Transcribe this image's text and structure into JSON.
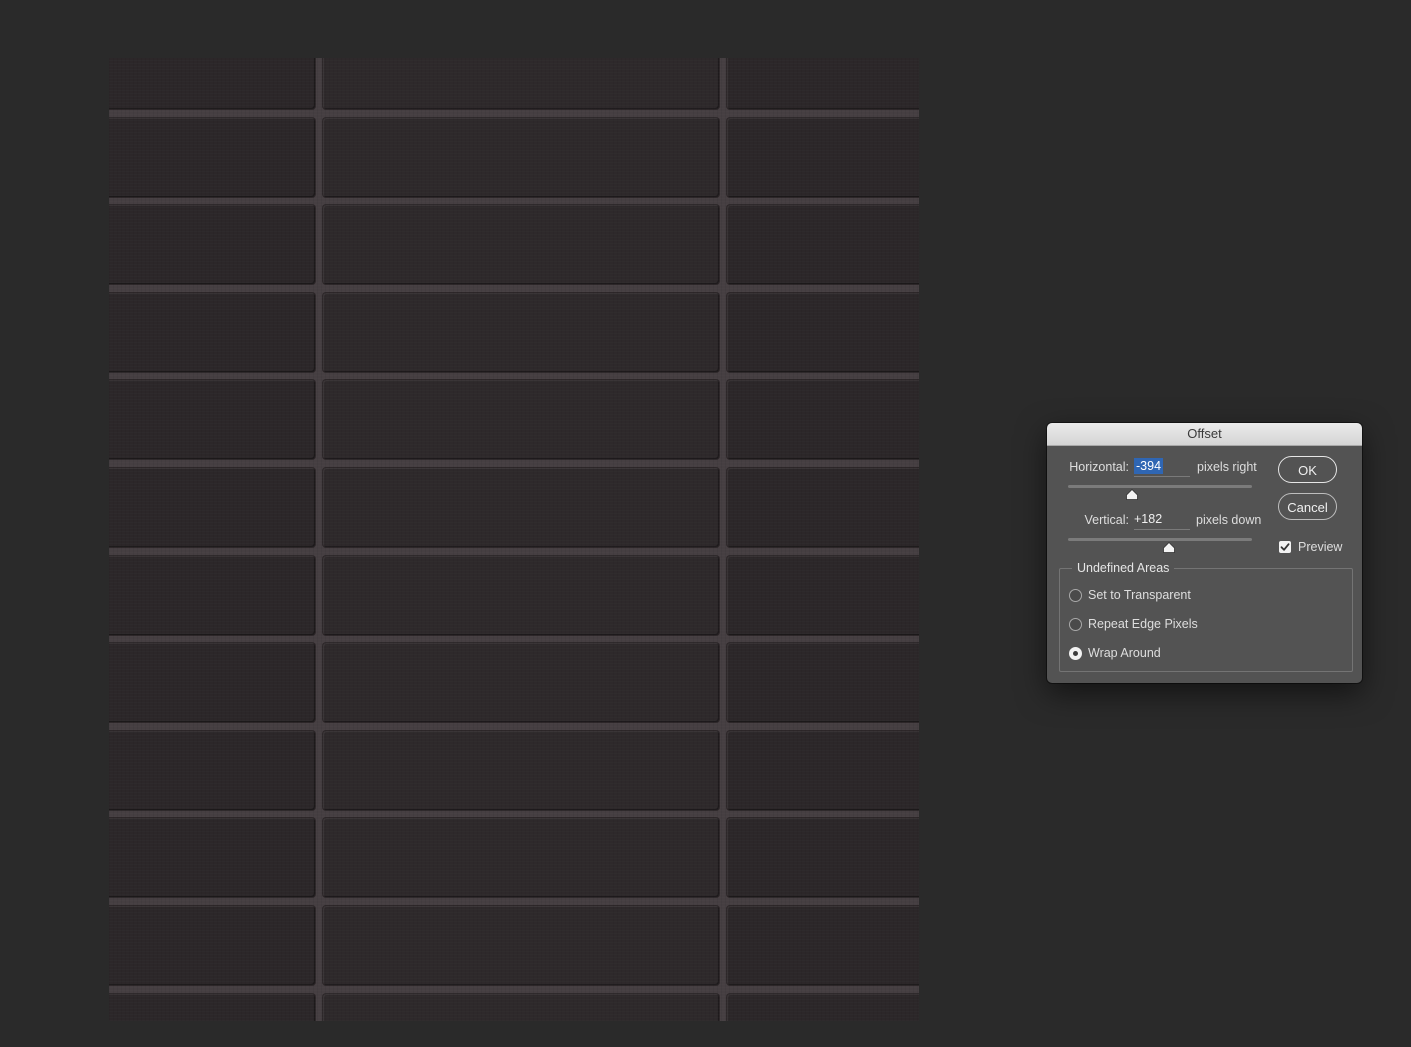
{
  "dialog": {
    "title": "Offset",
    "horizontal": {
      "label": "Horizontal:",
      "value": "-394",
      "unit": "pixels right",
      "slider_fraction": 0.35
    },
    "vertical": {
      "label": "Vertical:",
      "value": "+182",
      "unit": "pixels down",
      "slider_fraction": 0.55
    },
    "buttons": {
      "ok": "OK",
      "cancel": "Cancel"
    },
    "preview": {
      "label": "Preview",
      "checked": true
    },
    "undefined_areas": {
      "title": "Undefined Areas",
      "options": [
        {
          "label": "Set to Transparent",
          "selected": false
        },
        {
          "label": "Repeat Edge Pixels",
          "selected": false
        },
        {
          "label": "Wrap Around",
          "selected": true
        }
      ]
    }
  },
  "colors": {
    "workspace": "#2a2a2a",
    "dialog_bg": "#535353",
    "selection": "#2f66b3",
    "tile": "#2c2729",
    "grout": "#463f42"
  }
}
